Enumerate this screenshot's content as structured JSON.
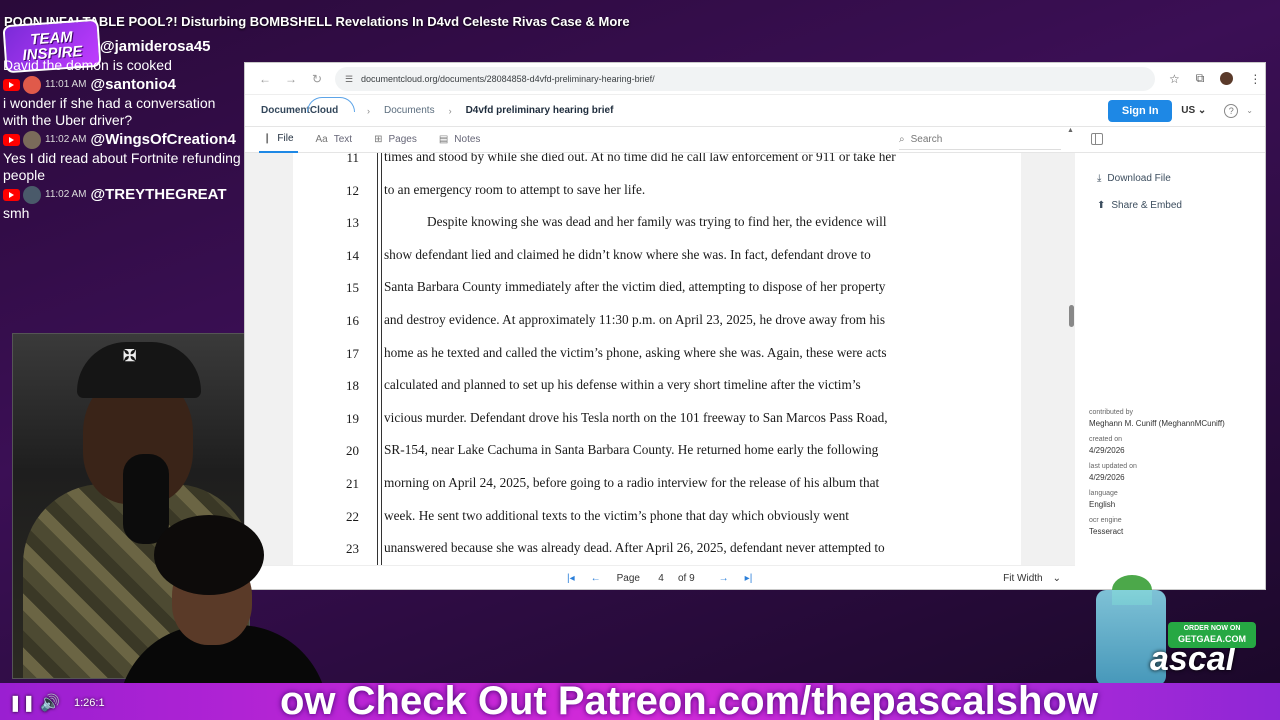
{
  "stream": {
    "title": "POON INFALTABLE POOL?! Disturbing BOMBSHELL Revelations In D4vd Celeste Rivas Case & More",
    "logo_line1": "TEAM",
    "logo_line2": "INSPIRE",
    "chat": [
      {
        "user": "@jamiderosa45",
        "time": "",
        "message": "David the demon is cooked"
      },
      {
        "user": "@santonio4",
        "time": "11:01 AM",
        "message": "i wonder if she had a conversation with the Uber driver?"
      },
      {
        "user": "@WingsOfCreation4",
        "time": "11:02 AM",
        "message": "Yes I did read about Fortnite refunding people"
      },
      {
        "user": "@TREYTHEGREAT",
        "time": "11:02 AM",
        "message": "smh"
      }
    ],
    "ticker": "ow Check Out Patreon.com/thepascalshow",
    "player_time": "1:26:1",
    "promo_line1": "ORDER NOW ON",
    "promo_line2": "GETGAEA.COM",
    "pascal_text": "ascal"
  },
  "browser": {
    "url": "documentcloud.org/documents/28084858-d4vfd-preliminary-hearing-brief/",
    "brand": "DocumentCloud",
    "breadcrumb": [
      "Documents",
      "D4vfd preliminary hearing brief"
    ],
    "signin_label": "Sign In",
    "lang": "US",
    "tabs": [
      "File",
      "Text",
      "Pages",
      "Notes"
    ],
    "search_placeholder": "Search",
    "document": {
      "lines": [
        {
          "no": "11",
          "text": "times and stood by while she died out. At no time did he call law enforcement or 911 or take her",
          "indent": false
        },
        {
          "no": "12",
          "text": "to an emergency room to attempt to save her life.",
          "indent": false
        },
        {
          "no": "13",
          "text": "Despite knowing she was dead and her family was trying to find her, the evidence will",
          "indent": true
        },
        {
          "no": "14",
          "text": "show defendant lied and claimed he didn’t know where she was. In fact, defendant drove to",
          "indent": false
        },
        {
          "no": "15",
          "text": "Santa Barbara County immediately after the victim died, attempting to dispose of her property",
          "indent": false
        },
        {
          "no": "16",
          "text": "and destroy evidence. At approximately 11:30 p.m. on April 23, 2025, he drove away from his",
          "indent": false
        },
        {
          "no": "17",
          "text": "home as he texted and called the victim’s phone, asking where she was. Again, these were acts",
          "indent": false
        },
        {
          "no": "18",
          "text": "calculated and planned to set up his defense within a very short timeline after the victim’s",
          "indent": false
        },
        {
          "no": "19",
          "text": "vicious murder. Defendant drove his Tesla north on the 101 freeway to San Marcos Pass Road,",
          "indent": false
        },
        {
          "no": "20",
          "text": "SR-154, near Lake Cachuma in Santa Barbara County. He returned home early the following",
          "indent": false
        },
        {
          "no": "21",
          "text": "morning on April 24, 2025, before going to a radio interview for the release of his album that",
          "indent": false
        },
        {
          "no": "22",
          "text": "week. He sent two additional texts to the victim’s phone that day which obviously went",
          "indent": false
        },
        {
          "no": "23",
          "text": "unanswered because she was already dead. After April 26, 2025, defendant never attempted to",
          "indent": false
        }
      ]
    },
    "pager": {
      "page_label": "Page",
      "current": "4",
      "of": "of 9",
      "fit": "Fit Width"
    },
    "side": {
      "download": "Download File",
      "share": "Share & Embed",
      "meta": [
        {
          "label": "contributed by",
          "value": "Meghann M. Cuniff (MeghannMCuniff)"
        },
        {
          "label": "created on",
          "value": "4/29/2026"
        },
        {
          "label": "last updated on",
          "value": "4/29/2026"
        },
        {
          "label": "language",
          "value": "English"
        },
        {
          "label": "ocr engine",
          "value": "Tesseract"
        }
      ]
    }
  }
}
